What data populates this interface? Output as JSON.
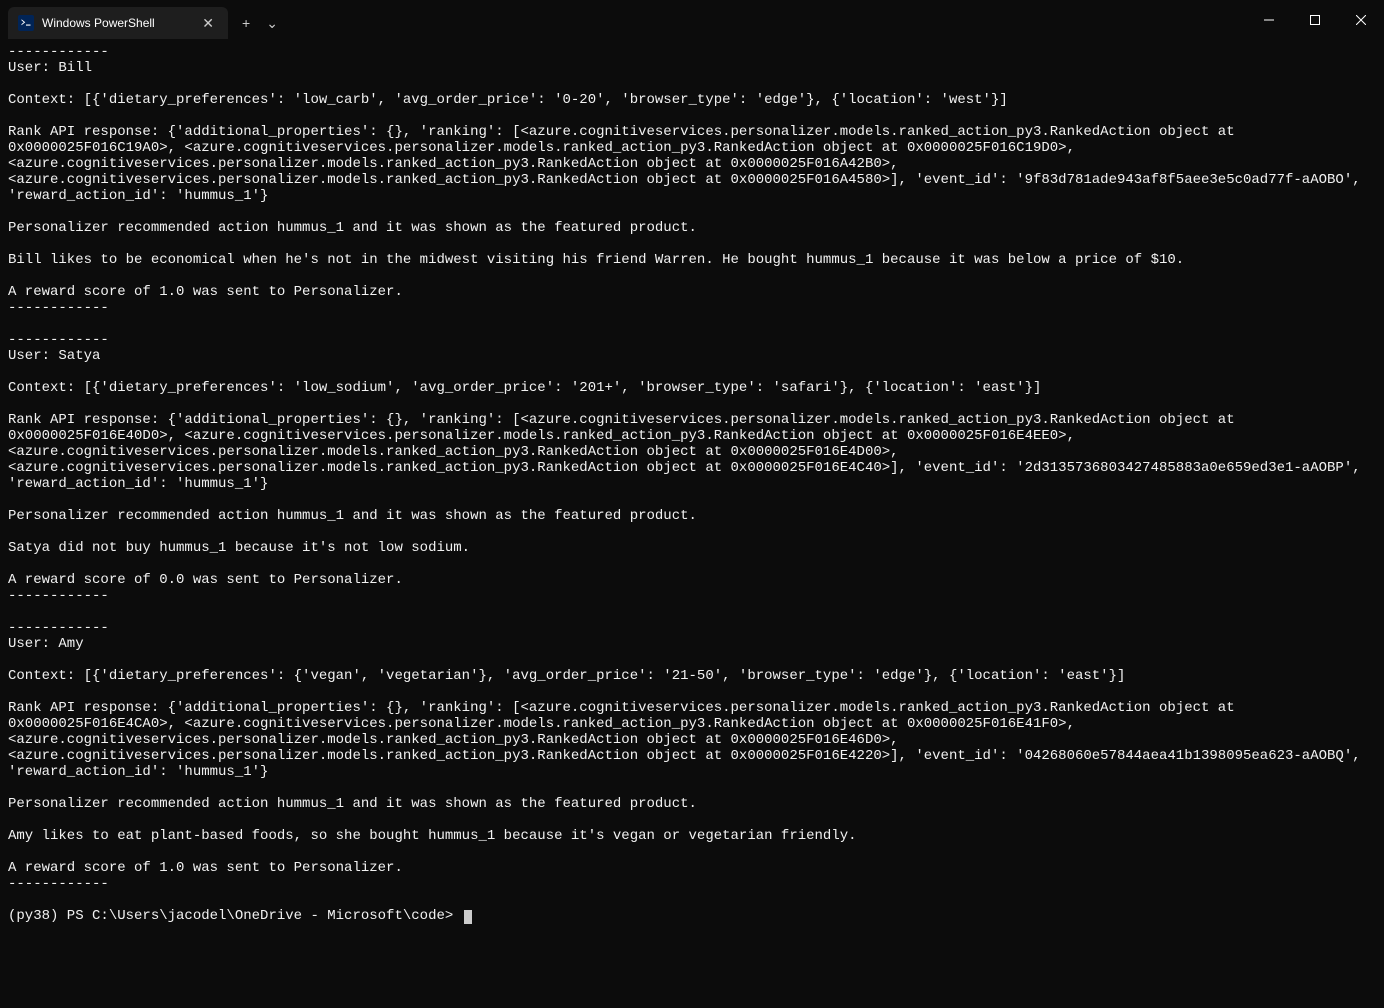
{
  "window": {
    "tab_title": "Windows PowerShell",
    "controls": {
      "minimize": "─",
      "maximize": "▢",
      "close": "✕",
      "new_tab": "+",
      "dropdown": "⌄",
      "tab_close": "✕"
    }
  },
  "terminal": {
    "lines": [
      "------------",
      "User: Bill",
      "",
      "Context: [{'dietary_preferences': 'low_carb', 'avg_order_price': '0-20', 'browser_type': 'edge'}, {'location': 'west'}]",
      "",
      "Rank API response: {'additional_properties': {}, 'ranking': [<azure.cognitiveservices.personalizer.models.ranked_action_py3.RankedAction object at 0x0000025F016C19A0>, <azure.cognitiveservices.personalizer.models.ranked_action_py3.RankedAction object at 0x0000025F016C19D0>, <azure.cognitiveservices.personalizer.models.ranked_action_py3.RankedAction object at 0x0000025F016A42B0>, <azure.cognitiveservices.personalizer.models.ranked_action_py3.RankedAction object at 0x0000025F016A4580>], 'event_id': '9f83d781ade943af8f5aee3e5c0ad77f-aAOBO', 'reward_action_id': 'hummus_1'}",
      "",
      "Personalizer recommended action hummus_1 and it was shown as the featured product.",
      "",
      "Bill likes to be economical when he's not in the midwest visiting his friend Warren. He bought hummus_1 because it was below a price of $10.",
      "",
      "A reward score of 1.0 was sent to Personalizer.",
      "------------",
      "",
      "------------",
      "User: Satya",
      "",
      "Context: [{'dietary_preferences': 'low_sodium', 'avg_order_price': '201+', 'browser_type': 'safari'}, {'location': 'east'}]",
      "",
      "Rank API response: {'additional_properties': {}, 'ranking': [<azure.cognitiveservices.personalizer.models.ranked_action_py3.RankedAction object at 0x0000025F016E40D0>, <azure.cognitiveservices.personalizer.models.ranked_action_py3.RankedAction object at 0x0000025F016E4EE0>, <azure.cognitiveservices.personalizer.models.ranked_action_py3.RankedAction object at 0x0000025F016E4D00>, <azure.cognitiveservices.personalizer.models.ranked_action_py3.RankedAction object at 0x0000025F016E4C40>], 'event_id': '2d3135736803427485883a0e659ed3e1-aAOBP', 'reward_action_id': 'hummus_1'}",
      "",
      "Personalizer recommended action hummus_1 and it was shown as the featured product.",
      "",
      "Satya did not buy hummus_1 because it's not low sodium.",
      "",
      "A reward score of 0.0 was sent to Personalizer.",
      "------------",
      "",
      "------------",
      "User: Amy",
      "",
      "Context: [{'dietary_preferences': {'vegan', 'vegetarian'}, 'avg_order_price': '21-50', 'browser_type': 'edge'}, {'location': 'east'}]",
      "",
      "Rank API response: {'additional_properties': {}, 'ranking': [<azure.cognitiveservices.personalizer.models.ranked_action_py3.RankedAction object at 0x0000025F016E4CA0>, <azure.cognitiveservices.personalizer.models.ranked_action_py3.RankedAction object at 0x0000025F016E41F0>, <azure.cognitiveservices.personalizer.models.ranked_action_py3.RankedAction object at 0x0000025F016E46D0>, <azure.cognitiveservices.personalizer.models.ranked_action_py3.RankedAction object at 0x0000025F016E4220>], 'event_id': '04268060e57844aea41b1398095ea623-aAOBQ', 'reward_action_id': 'hummus_1'}",
      "",
      "Personalizer recommended action hummus_1 and it was shown as the featured product.",
      "",
      "Amy likes to eat plant-based foods, so she bought hummus_1 because it's vegan or vegetarian friendly.",
      "",
      "A reward score of 1.0 was sent to Personalizer.",
      "------------",
      ""
    ],
    "prompt": "(py38) PS C:\\Users\\jacodel\\OneDrive - Microsoft\\code> "
  }
}
